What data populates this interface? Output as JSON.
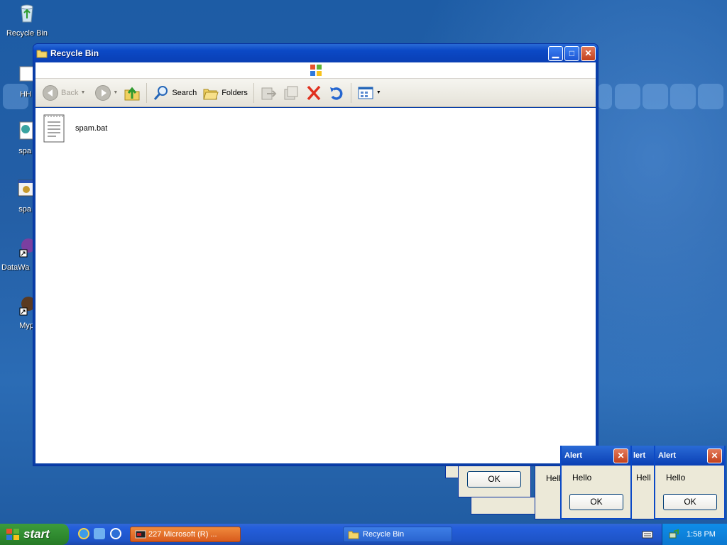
{
  "desktop": {
    "icons": [
      {
        "label": "Recycle Bin",
        "icon": "recycle-bin-icon"
      },
      {
        "label": "HH",
        "icon": "folder-icon"
      },
      {
        "label": "spa",
        "icon": "script-icon"
      },
      {
        "label": "spa",
        "icon": "app-window-icon"
      },
      {
        "label": "DataWa",
        "icon": "shortcut-icon"
      },
      {
        "label": "Myp",
        "icon": "shortcut-icon"
      }
    ]
  },
  "explorer": {
    "title": "Recycle Bin",
    "toolbar": {
      "back_label": "Back",
      "search_label": "Search",
      "folders_label": "Folders"
    },
    "files": [
      {
        "name": "spam.bat",
        "icon": "text-file-icon"
      }
    ]
  },
  "alerts": [
    {
      "title": "Alert",
      "message": "Hello",
      "ok": "OK"
    },
    {
      "title": "Alert",
      "message": "Hello",
      "ok": "OK"
    }
  ],
  "background_dialogs": {
    "ok_label": "OK",
    "partial_titles": [
      "lert",
      "Hell",
      "Hell"
    ]
  },
  "taskbar": {
    "start_label": "start",
    "tasks": [
      {
        "label": "227 Microsoft (R) ...",
        "active": true
      },
      {
        "label": "Recycle Bin",
        "active": false
      }
    ],
    "clock": "1:58 PM"
  },
  "colors": {
    "desktop": "#245fa6",
    "titlebar": "#0b49c6",
    "start": "#2f8a2f",
    "active_task": "#e06a28"
  }
}
